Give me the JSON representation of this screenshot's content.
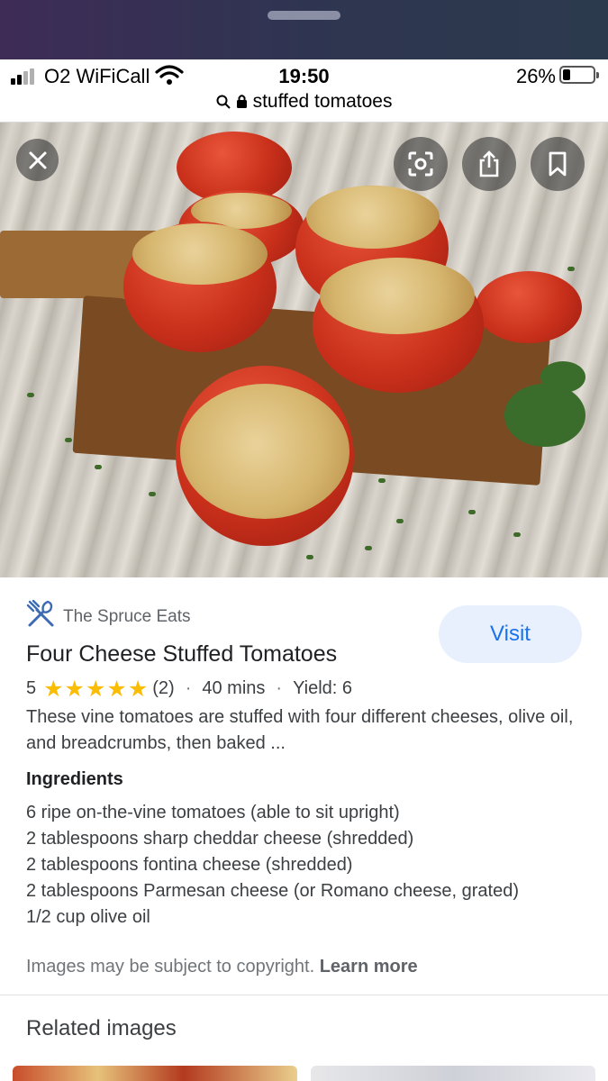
{
  "status_bar": {
    "carrier": "O2 WiFiCall",
    "time": "19:50",
    "battery": "26%",
    "battery_level": 0.26,
    "url": "stuffed tomatoes"
  },
  "hero": {
    "image_description": "stuffed tomatoes on wooden board",
    "icons": [
      "close-icon",
      "lens-icon",
      "share-icon",
      "bookmark-icon"
    ]
  },
  "result": {
    "source": "The Spruce Eats",
    "visit_label": "Visit",
    "title": "Four Cheese Stuffed Tomatoes",
    "rating": "5",
    "rating_stars": 5,
    "review_count": "(2)",
    "time": "40 mins",
    "yield": "Yield: 6",
    "description": "These vine tomatoes are stuffed with four different cheeses, olive oil, and breadcrumbs, then baked ...",
    "ingredients_heading": "Ingredients",
    "ingredients": [
      "6 ripe on-the-vine tomatoes (able to sit upright)",
      "2 tablespoons sharp cheddar cheese (shredded)",
      "2 tablespoons fontina cheese (shredded)",
      "2 tablespoons Parmesan cheese (or Romano cheese, grated)",
      "1/2 cup olive oil"
    ]
  },
  "footer": {
    "copyright": "Images may be subject to copyright.",
    "learn_more": "Learn more",
    "related_heading": "Related images"
  },
  "colors": {
    "accent": "#1a73e8",
    "visit_bg": "#e8f0fe",
    "star": "#fbbc04"
  }
}
